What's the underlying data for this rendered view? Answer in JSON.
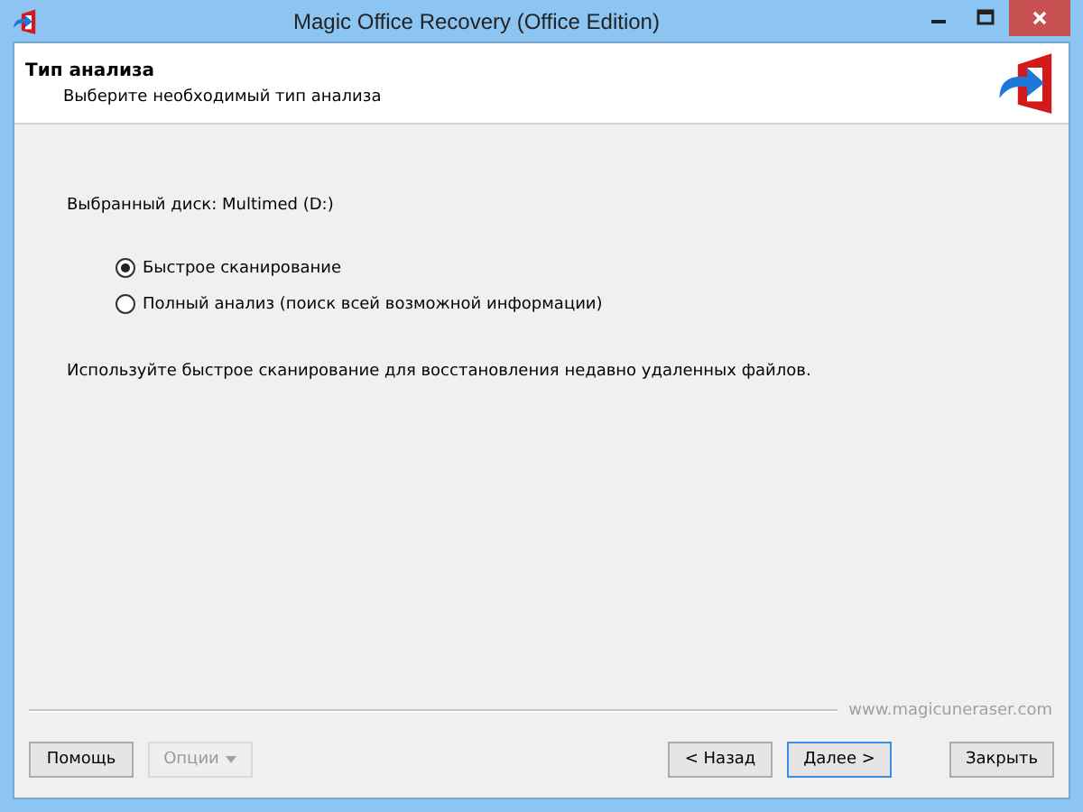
{
  "window": {
    "title": "Magic Office Recovery (Office Edition)"
  },
  "header": {
    "title": "Тип анализа",
    "subtitle": "Выберите необходимый тип анализа"
  },
  "disk_label": "Выбранный диск: Multimed (D:)",
  "options": [
    {
      "label": "Быстрое сканирование",
      "selected": true
    },
    {
      "label": "Полный анализ (поиск всей возможной информации)",
      "selected": false
    }
  ],
  "description": "Используйте быстрое сканирование для восстановления недавно удаленных файлов.",
  "website": "www.magicuneraser.com",
  "button_groups": [
    [
      {
        "label": "Помощь",
        "disabled": false,
        "default": false,
        "menu": false
      },
      {
        "label": "Опции",
        "disabled": true,
        "default": false,
        "menu": true
      }
    ],
    [
      {
        "label": "< Назад",
        "disabled": false,
        "default": false,
        "menu": false
      },
      {
        "label": "Далее >",
        "disabled": false,
        "default": true,
        "menu": false
      }
    ],
    [
      {
        "label": "Закрыть",
        "disabled": false,
        "default": false,
        "menu": false
      }
    ]
  ]
}
